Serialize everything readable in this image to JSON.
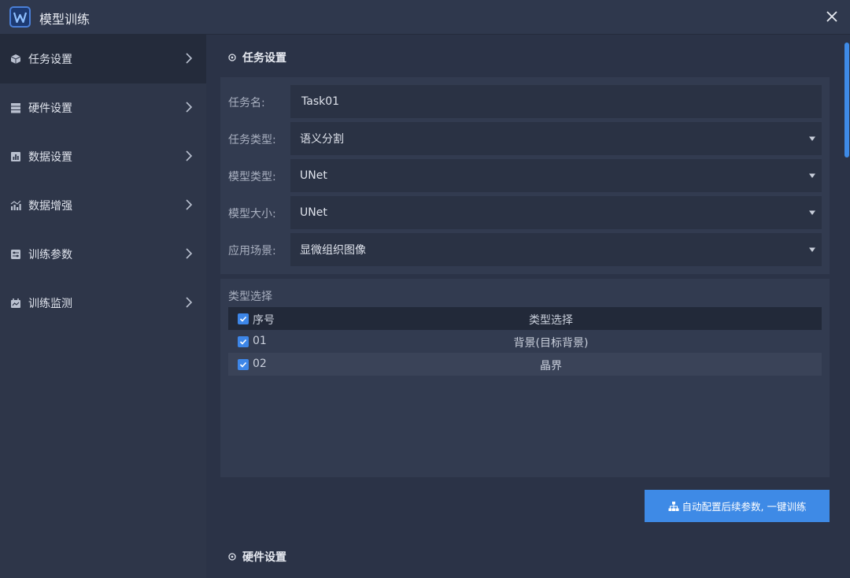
{
  "window": {
    "title": "模型训练"
  },
  "sidebar": {
    "items": [
      {
        "label": "任务设置",
        "icon": "cube-icon"
      },
      {
        "label": "硬件设置",
        "icon": "server-icon"
      },
      {
        "label": "数据设置",
        "icon": "bar-chart-icon"
      },
      {
        "label": "数据增强",
        "icon": "line-bar-chart-icon"
      },
      {
        "label": "训练参数",
        "icon": "sliders-icon"
      },
      {
        "label": "训练监测",
        "icon": "monitor-icon"
      }
    ],
    "active_index": 0
  },
  "task_section": {
    "title": "任务设置",
    "fields": {
      "task_name": {
        "label": "任务名:",
        "value": "Task01"
      },
      "task_type": {
        "label": "任务类型:",
        "value": "语义分割"
      },
      "model_type": {
        "label": "模型类型:",
        "value": "UNet"
      },
      "model_size": {
        "label": "模型大小:",
        "value": "UNet"
      },
      "scenario": {
        "label": "应用场景:",
        "value": "显微组织图像"
      }
    }
  },
  "type_selection": {
    "title": "类型选择",
    "columns": [
      "序号",
      "类型选择"
    ],
    "rows": [
      {
        "num": "01",
        "type": "背景(目标背景)",
        "checked": true
      },
      {
        "num": "02",
        "type": "晶界",
        "checked": true
      }
    ]
  },
  "auto_button": {
    "label": "自动配置后续参数, 一键训练"
  },
  "hardware_section": {
    "title": "硬件设置"
  },
  "colors": {
    "accent": "#3e8ae6",
    "background": "#2b3347",
    "sidebar": "#2e3649",
    "panel": "#323b50"
  }
}
